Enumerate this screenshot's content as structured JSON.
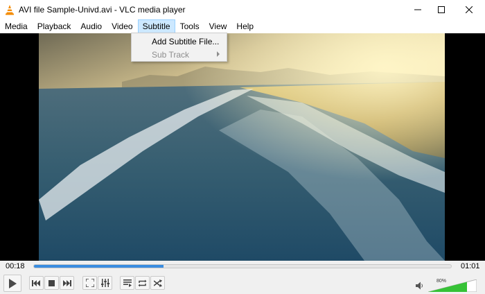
{
  "window": {
    "title": "AVI file Sample-Univd.avi - VLC media player",
    "icons": [
      "vlc-cone-icon",
      "minimize-icon",
      "maximize-icon",
      "close-icon"
    ]
  },
  "menubar": {
    "items": [
      "Media",
      "Playback",
      "Audio",
      "Video",
      "Subtitle",
      "Tools",
      "View",
      "Help"
    ],
    "active": "Subtitle"
  },
  "subtitle_menu": {
    "items": [
      {
        "label": "Add Subtitle File...",
        "enabled": true
      },
      {
        "label": "Sub Track",
        "enabled": false,
        "submenu": true
      }
    ]
  },
  "playback": {
    "elapsed": "00:18",
    "total": "01:01",
    "progress_fraction": 0.31
  },
  "controls": {
    "buttons": [
      "play-icon",
      "previous-icon",
      "stop-icon",
      "next-icon",
      "fullscreen-icon",
      "extended-settings-icon",
      "playlist-icon",
      "loop-icon",
      "shuffle-icon"
    ],
    "volume_label": "80%",
    "volume_fraction": 0.8
  },
  "colors": {
    "accent": "#3a8de0",
    "volume_green": "#36c236",
    "menu_highlight": "#cce8ff"
  }
}
